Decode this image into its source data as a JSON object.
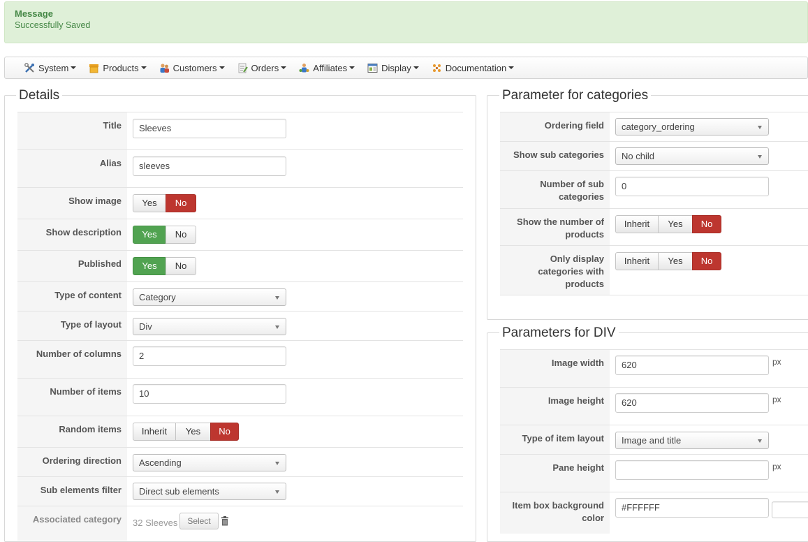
{
  "message": {
    "heading": "Message",
    "body": "Successfully Saved"
  },
  "nav": [
    {
      "label": "System",
      "icon": "tools-icon"
    },
    {
      "label": "Products",
      "icon": "products-icon"
    },
    {
      "label": "Customers",
      "icon": "customers-icon"
    },
    {
      "label": "Orders",
      "icon": "orders-icon"
    },
    {
      "label": "Affiliates",
      "icon": "affiliates-icon"
    },
    {
      "label": "Display",
      "icon": "display-icon"
    },
    {
      "label": "Documentation",
      "icon": "documentation-icon"
    }
  ],
  "details": {
    "legend": "Details",
    "title_label": "Title",
    "title_value": "Sleeves",
    "alias_label": "Alias",
    "alias_value": "sleeves",
    "show_image_label": "Show image",
    "show_description_label": "Show description",
    "published_label": "Published",
    "yes": "Yes",
    "no": "No",
    "inherit": "Inherit",
    "type_content_label": "Type of content",
    "type_content_value": "Category",
    "type_layout_label": "Type of layout",
    "type_layout_value": "Div",
    "num_columns_label": "Number of columns",
    "num_columns_value": "2",
    "num_items_label": "Number of items",
    "num_items_value": "10",
    "random_items_label": "Random items",
    "ordering_direction_label": "Ordering direction",
    "ordering_direction_value": "Ascending",
    "sub_filter_label": "Sub elements filter",
    "sub_filter_value": "Direct sub elements",
    "assoc_category_label": "Associated category",
    "assoc_category_value": "32 Sleeves",
    "select_label": "Select"
  },
  "categories": {
    "legend": "Parameter for categories",
    "ordering_field_label": "Ordering field",
    "ordering_field_value": "category_ordering",
    "show_sub_label": "Show sub categories",
    "show_sub_value": "No child",
    "num_sub_label_1": "Number of sub",
    "num_sub_label_2": "categories",
    "num_sub_value": "0",
    "show_num_products_label_1": "Show the number of",
    "show_num_products_label_2": "products",
    "only_display_label_1": "Only display",
    "only_display_label_2": "categories with",
    "only_display_label_3": "products"
  },
  "div": {
    "legend": "Parameters for DIV",
    "image_width_label": "Image width",
    "image_width_value": "620",
    "image_height_label": "Image height",
    "image_height_value": "620",
    "item_layout_label": "Type of item layout",
    "item_layout_value": "Image and title",
    "pane_height_label": "Pane height",
    "pane_height_value": "",
    "item_box_label_1": "Item box background",
    "item_box_label_2": "color",
    "item_box_value": "#FFFFFF",
    "unit": "px"
  }
}
